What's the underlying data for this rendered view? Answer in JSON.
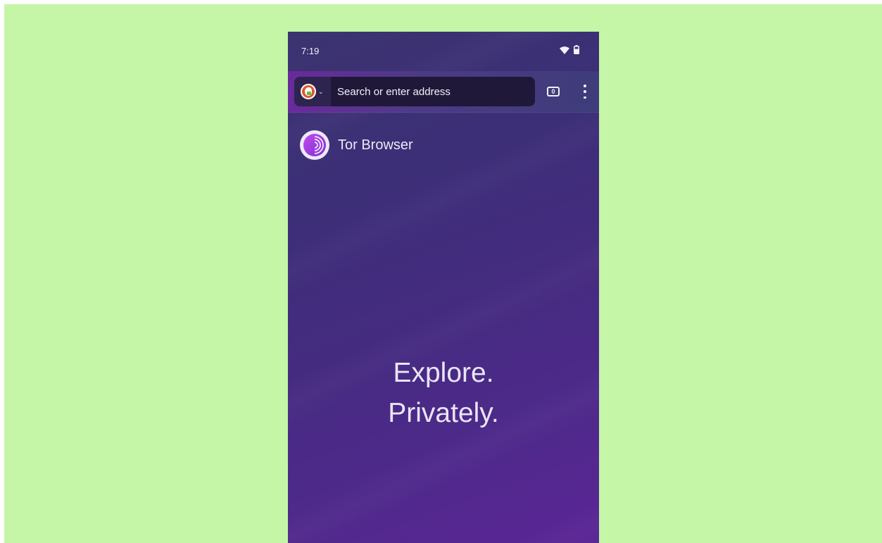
{
  "status_bar": {
    "time": "7:19",
    "icons": [
      "wifi-icon",
      "battery-icon"
    ]
  },
  "toolbar": {
    "search_engine_icon": "duckduckgo-icon",
    "url_placeholder": "Search or enter address",
    "tab_count": "0",
    "menu_icon": "more-vert-icon"
  },
  "home": {
    "brand_name": "Tor Browser",
    "brand_icon": "tor-onion-icon",
    "tagline_line1": "Explore.",
    "tagline_line2": "Privately."
  },
  "colors": {
    "backdrop": "#c5f5a7",
    "accent": "#6a2a9c",
    "urlbar": "#1f1838",
    "background_top": "#3b3470",
    "background_bottom": "#5b2595"
  }
}
